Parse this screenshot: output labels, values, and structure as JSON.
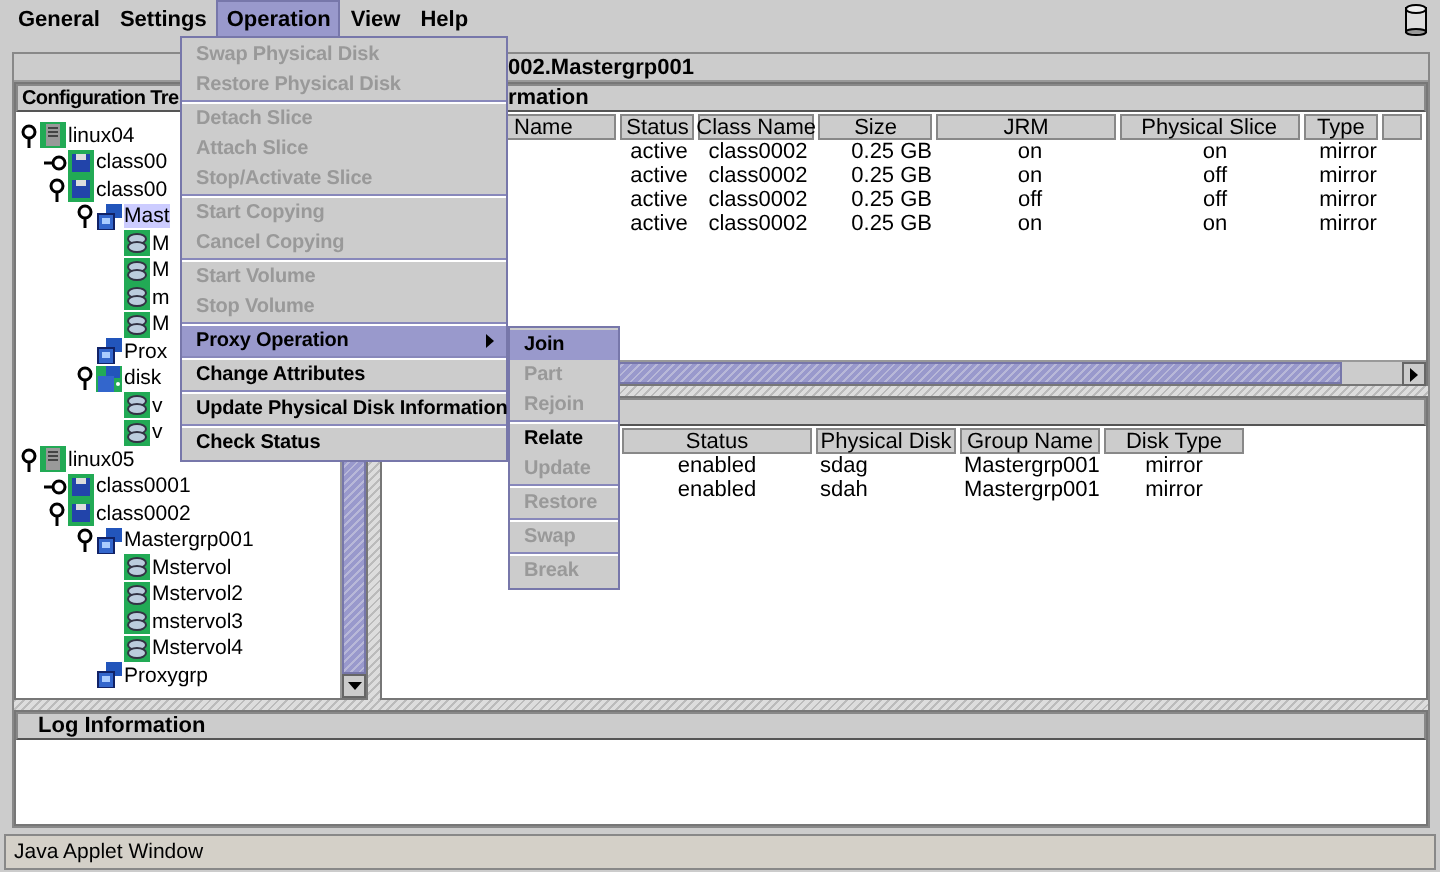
{
  "menu_bar": [
    {
      "label": "General",
      "selected": false
    },
    {
      "label": "Settings",
      "selected": false
    },
    {
      "label": "Operation",
      "selected": true
    },
    {
      "label": "View",
      "selected": false
    },
    {
      "label": "Help",
      "selected": false
    }
  ],
  "main_title": "002.Mastergrp001",
  "tree_panel": {
    "title": "Configuration Tre",
    "nodes": [
      {
        "label": "linux04",
        "kind": "server",
        "expanded": true,
        "selected": false,
        "children": [
          {
            "label": "class00",
            "kind": "class",
            "expanded": false,
            "selected": false
          },
          {
            "label": "class00",
            "kind": "class",
            "expanded": true,
            "selected": false,
            "children": [
              {
                "label": "Mast",
                "kind": "group",
                "expanded": true,
                "selected": true,
                "children": [
                  {
                    "label": "M",
                    "kind": "volume",
                    "selected": false
                  },
                  {
                    "label": "M",
                    "kind": "volume",
                    "selected": false
                  },
                  {
                    "label": "m",
                    "kind": "volume",
                    "selected": false
                  },
                  {
                    "label": "M",
                    "kind": "volume",
                    "selected": false
                  }
                ]
              },
              {
                "label": "Prox",
                "kind": "group",
                "selected": false
              },
              {
                "label": "disk",
                "kind": "disks",
                "expanded": true,
                "selected": false,
                "children": [
                  {
                    "label": "v",
                    "kind": "volume",
                    "selected": false
                  },
                  {
                    "label": "v",
                    "kind": "volume",
                    "selected": false
                  }
                ]
              }
            ]
          }
        ]
      },
      {
        "label": "linux05",
        "kind": "server",
        "expanded": true,
        "selected": false,
        "children": [
          {
            "label": "class0001",
            "kind": "class",
            "expanded": false,
            "selected": false
          },
          {
            "label": "class0002",
            "kind": "class",
            "expanded": true,
            "selected": false,
            "children": [
              {
                "label": "Mastergrp001",
                "kind": "group",
                "expanded": true,
                "selected": false,
                "children": [
                  {
                    "label": "Mstervol",
                    "kind": "volume",
                    "selected": false
                  },
                  {
                    "label": "Mstervol2",
                    "kind": "volume",
                    "selected": false
                  },
                  {
                    "label": "mstervol3",
                    "kind": "volume",
                    "selected": false
                  },
                  {
                    "label": "Mstervol4",
                    "kind": "volume",
                    "selected": false
                  }
                ]
              },
              {
                "label": "Proxygrp",
                "kind": "group",
                "selected": false
              }
            ]
          }
        ]
      }
    ]
  },
  "upper_panel": {
    "title": "rmation",
    "table": {
      "columns": [
        "Name",
        "Status",
        "Class Name",
        "Size",
        "JRM",
        "Physical Slice",
        "Type"
      ],
      "rows": [
        [
          "",
          "active",
          "class0002",
          "0.25 GB",
          "on",
          "on",
          "mirror"
        ],
        [
          "",
          "active",
          "class0002",
          "0.25 GB",
          "on",
          "off",
          "mirror"
        ],
        [
          "",
          "active",
          "class0002",
          "0.25 GB",
          "off",
          "off",
          "mirror"
        ],
        [
          "",
          "active",
          "class0002",
          "0.25 GB",
          "on",
          "on",
          "mirror"
        ]
      ]
    }
  },
  "lower_panel": {
    "table": {
      "columns": [
        "Status",
        "Physical Disk",
        "Group Name",
        "Disk Type"
      ],
      "rows": [
        [
          "enabled",
          "sdag",
          "Mastergrp001",
          "mirror"
        ],
        [
          "enabled",
          "sdah",
          "Mastergrp001",
          "mirror"
        ]
      ]
    }
  },
  "log_panel": {
    "title": "Log Information"
  },
  "status_bar": "Java Applet Window",
  "operation_menu": {
    "groups": [
      [
        {
          "label": "Swap Physical Disk",
          "disabled": true,
          "selected": false
        },
        {
          "label": "Restore Physical Disk",
          "disabled": true,
          "selected": false
        }
      ],
      [
        {
          "label": "Detach Slice",
          "disabled": true,
          "selected": false
        },
        {
          "label": "Attach Slice",
          "disabled": true,
          "selected": false
        },
        {
          "label": "Stop/Activate Slice",
          "disabled": true,
          "selected": false
        }
      ],
      [
        {
          "label": "Start Copying",
          "disabled": true,
          "selected": false
        },
        {
          "label": "Cancel Copying",
          "disabled": true,
          "selected": false
        }
      ],
      [
        {
          "label": "Start Volume",
          "disabled": true,
          "selected": false
        },
        {
          "label": "Stop Volume",
          "disabled": true,
          "selected": false
        }
      ],
      [
        {
          "label": "Proxy Operation",
          "disabled": false,
          "selected": true,
          "submenu": true
        }
      ],
      [
        {
          "label": "Change Attributes",
          "disabled": false,
          "selected": false
        }
      ],
      [
        {
          "label": "Update Physical Disk Information",
          "disabled": false,
          "selected": false
        }
      ],
      [
        {
          "label": "Check Status",
          "disabled": false,
          "selected": false
        }
      ]
    ]
  },
  "proxy_submenu": {
    "groups": [
      [
        {
          "label": "Join",
          "disabled": false,
          "selected": true
        },
        {
          "label": "Part",
          "disabled": true,
          "selected": false
        },
        {
          "label": "Rejoin",
          "disabled": true,
          "selected": false
        }
      ],
      [
        {
          "label": "Relate",
          "disabled": false,
          "selected": false
        },
        {
          "label": "Update",
          "disabled": true,
          "selected": false
        }
      ],
      [
        {
          "label": "Restore",
          "disabled": true,
          "selected": false
        }
      ],
      [
        {
          "label": "Swap",
          "disabled": true,
          "selected": false
        }
      ],
      [
        {
          "label": "Break",
          "disabled": true,
          "selected": false
        }
      ]
    ]
  }
}
